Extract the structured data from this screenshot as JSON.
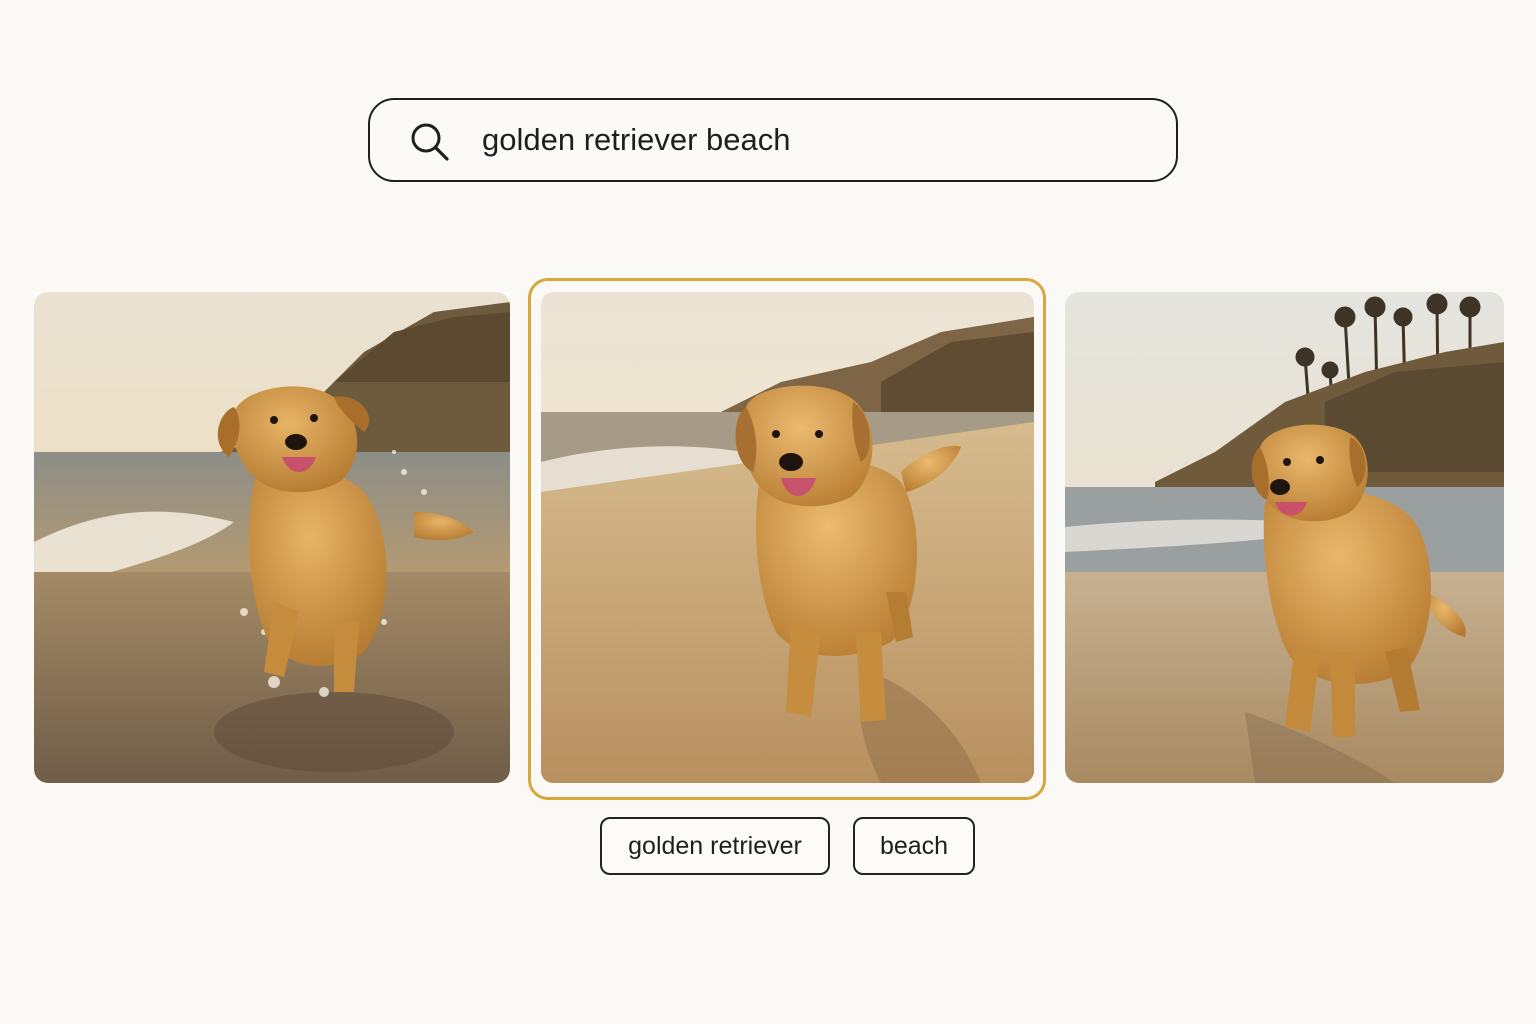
{
  "search": {
    "query": "golden retriever beach",
    "icon": "search-icon"
  },
  "results": [
    {
      "scene": "dog running through surf splash at golden hour",
      "selected": false
    },
    {
      "scene": "dog walking on wet sand with waves behind",
      "selected": true
    },
    {
      "scene": "dog standing on shore with palm-topped cliff",
      "selected": false
    }
  ],
  "tags": [
    {
      "label": "golden retriever"
    },
    {
      "label": "beach"
    }
  ],
  "colors": {
    "background": "#faf9f5",
    "selection_accent": "#d8a73e",
    "border": "#1f1f1f",
    "dog_fur": "#d49a45",
    "sand": "#caa36a",
    "sky": "#f2e3c4"
  }
}
